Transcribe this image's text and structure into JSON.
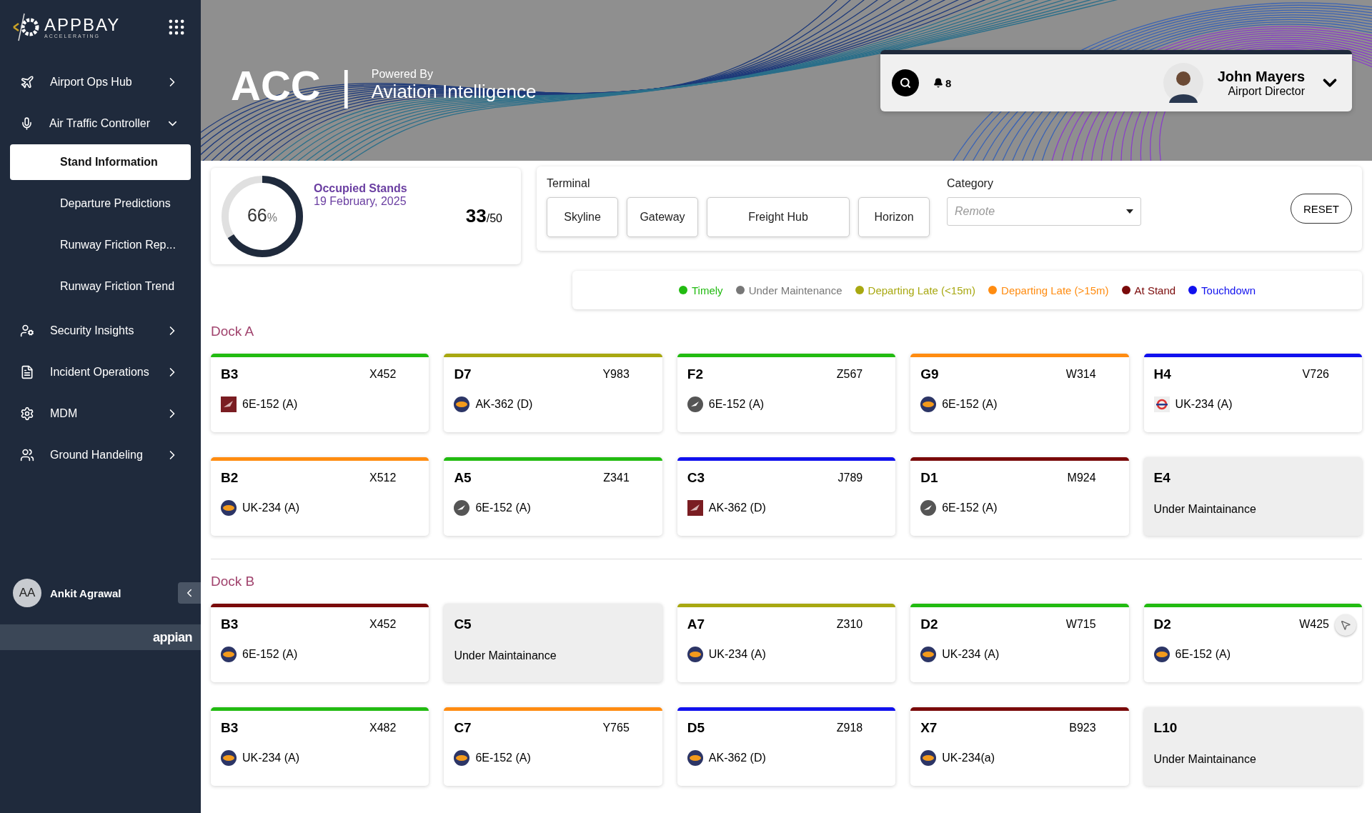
{
  "brand": {
    "name": "APPBAY",
    "tagline": "ACCELERATING"
  },
  "sidebar": {
    "items": [
      {
        "label": "Airport Ops Hub",
        "expanded": false
      },
      {
        "label": "Air Traffic Controller",
        "expanded": true,
        "children": [
          {
            "label": "Stand Information",
            "selected": true
          },
          {
            "label": "Departure Predictions",
            "selected": false
          },
          {
            "label": "Runway Friction Rep...",
            "selected": false
          },
          {
            "label": "Runway Friction Trend",
            "selected": false
          }
        ]
      },
      {
        "label": "Security Insights",
        "expanded": false
      },
      {
        "label": "Incident Operations",
        "expanded": false
      },
      {
        "label": "MDM",
        "expanded": false
      },
      {
        "label": "Ground Handeling",
        "expanded": false
      }
    ],
    "user": {
      "initials": "AA",
      "name": "Ankit Agrawal"
    },
    "footer": "appian"
  },
  "header": {
    "title": "ACC",
    "separator": "|",
    "powered_by": "Powered By",
    "subtitle": "Aviation Intelligence",
    "notifications": "8",
    "user": {
      "name": "John Mayers",
      "role": "Airport Director"
    }
  },
  "summary": {
    "title": "Occupied Stands",
    "date": "19 February, 2025",
    "percent": "66",
    "percent_sign": "%",
    "level": 0.66,
    "count": "33",
    "total": "/50"
  },
  "filters": {
    "terminal_label": "Terminal",
    "terminals": [
      {
        "label": "Skyline",
        "selected": false
      },
      {
        "label": "Gateway",
        "selected": false
      },
      {
        "label": "Freight Hub",
        "selected": false
      },
      {
        "label": "Horizon",
        "selected": false
      }
    ],
    "category_label": "Category",
    "category_placeholder": "Remote",
    "reset": "RESET"
  },
  "legend": [
    {
      "label": "Timely",
      "color": "#22bb11"
    },
    {
      "label": "Under Maintenance",
      "color": "#777777"
    },
    {
      "label": "Departing Late (<15m)",
      "color": "#a8a811"
    },
    {
      "label": "Departing Late (>15m)",
      "color": "#ff8c11"
    },
    {
      "label": "At Stand",
      "color": "#7a0a0a"
    },
    {
      "label": "Touchdown",
      "color": "#1111ee"
    }
  ],
  "docks": [
    {
      "title": "Dock A",
      "stands": [
        {
          "kind": "flight",
          "stand": "B3",
          "code": "X452",
          "flight": "6E-152 (A)",
          "color": "#22bb11"
        },
        {
          "kind": "flight",
          "stand": "D7",
          "code": "Y983",
          "flight": "AK-362 (D)",
          "color": "#a8a811"
        },
        {
          "kind": "flight",
          "stand": "F2",
          "code": "Z567",
          "flight": "6E-152 (A)",
          "color": "#22bb11"
        },
        {
          "kind": "flight",
          "stand": "G9",
          "code": "W314",
          "flight": "6E-152 (A)",
          "color": "#ff8c11"
        },
        {
          "kind": "flight",
          "stand": "H4",
          "code": "V726",
          "flight": "UK-234 (A)",
          "color": "#1111ee"
        },
        {
          "kind": "flight",
          "stand": "B2",
          "code": "X512",
          "flight": "UK-234 (A)",
          "color": "#ff8c11"
        },
        {
          "kind": "flight",
          "stand": "A5",
          "code": "Z341",
          "flight": "6E-152 (A)",
          "color": "#22bb11"
        },
        {
          "kind": "flight",
          "stand": "C3",
          "code": "J789",
          "flight": "AK-362 (D)",
          "color": "#1111ee"
        },
        {
          "kind": "flight",
          "stand": "D1",
          "code": "M924",
          "flight": "6E-152 (A)",
          "color": "#7a0a0a"
        },
        {
          "kind": "maintenance",
          "stand": "E4",
          "note": "Under Maintainance"
        }
      ]
    },
    {
      "title": "Dock B",
      "stands": [
        {
          "kind": "flight",
          "stand": "B3",
          "code": "X452",
          "flight": "6E-152 (A)",
          "color": "#7a0a0a"
        },
        {
          "kind": "maintenance",
          "stand": "C5",
          "note": "Under Maintainance"
        },
        {
          "kind": "flight",
          "stand": "A7",
          "code": "Z310",
          "flight": "UK-234 (A)",
          "color": "#a8a811"
        },
        {
          "kind": "flight",
          "stand": "D2",
          "code": "W715",
          "flight": "UK-234 (A)",
          "color": "#22bb11"
        },
        {
          "kind": "flight",
          "stand": "D2",
          "code": "W425",
          "flight": "6E-152 (A)",
          "color": "#22bb11"
        },
        {
          "kind": "flight",
          "stand": "B3",
          "code": "X482",
          "flight": "UK-234 (A)",
          "color": "#22bb11"
        },
        {
          "kind": "flight",
          "stand": "C7",
          "code": "Y765",
          "flight": "6E-152 (A)",
          "color": "#ff8c11"
        },
        {
          "kind": "flight",
          "stand": "D5",
          "code": "Z918",
          "flight": "AK-362 (D)",
          "color": "#1111ee"
        },
        {
          "kind": "flight",
          "stand": "X7",
          "code": "B923",
          "flight": "UK-234(a)",
          "color": "#7a0a0a"
        },
        {
          "kind": "maintenance",
          "stand": "L10",
          "note": "Under Maintainance"
        }
      ]
    }
  ]
}
